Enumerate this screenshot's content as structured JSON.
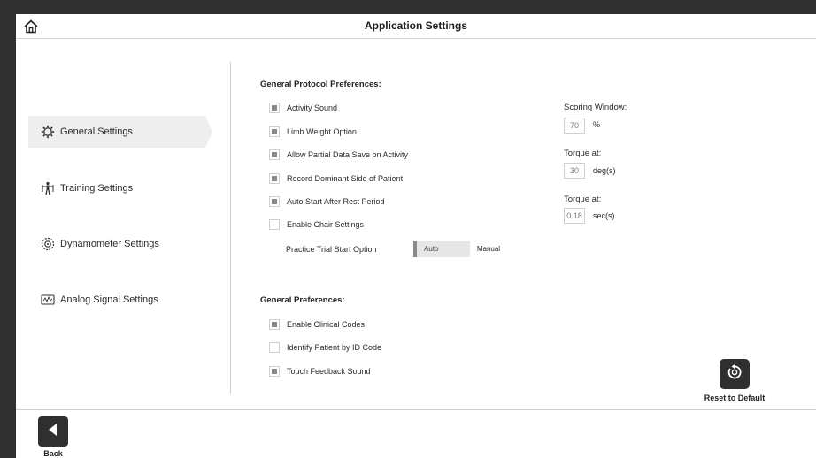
{
  "header": {
    "title": "Application Settings",
    "home_icon": "home-icon"
  },
  "sidebar": {
    "items": [
      {
        "label": "General Settings",
        "icon": "gear-icon",
        "active": true
      },
      {
        "label": "Training Settings",
        "icon": "training-figure-icon",
        "active": false
      },
      {
        "label": "Dynamometer Settings",
        "icon": "dynamometer-icon",
        "active": false
      },
      {
        "label": "Analog Signal Settings",
        "icon": "analog-signal-icon",
        "active": false
      }
    ]
  },
  "protocol": {
    "title": "General Protocol Preferences:",
    "options": [
      {
        "label": "Activity Sound",
        "checked": true
      },
      {
        "label": "Limb Weight Option",
        "checked": true
      },
      {
        "label": "Allow Partial Data Save on Activity",
        "checked": true
      },
      {
        "label": "Record Dominant Side of Patient",
        "checked": true
      },
      {
        "label": "Auto Start After Rest Period",
        "checked": true
      },
      {
        "label": "Enable Chair Settings",
        "checked": false
      }
    ],
    "practice_label": "Practice Trial Start Option",
    "practice_options": {
      "auto": "Auto",
      "manual": "Manual",
      "selected": "Auto"
    }
  },
  "scoring": {
    "scoring_window": {
      "label": "Scoring Window:",
      "value": "70",
      "unit": "%"
    },
    "torque_deg": {
      "label": "Torque at:",
      "value": "30",
      "unit": "deg(s)"
    },
    "torque_sec": {
      "label": "Torque at:",
      "value": "0.18",
      "unit": "sec(s)"
    }
  },
  "general": {
    "title": "General Preferences:",
    "options": [
      {
        "label": "Enable Clinical Codes",
        "checked": true
      },
      {
        "label": "Identify Patient by ID Code",
        "checked": false
      },
      {
        "label": "Touch Feedback Sound",
        "checked": true
      }
    ]
  },
  "actions": {
    "reset_label": "Reset to Default",
    "back_label": "Back"
  },
  "colors": {
    "dark": "#2f2f2f",
    "checked_fill": "#8a8a8a",
    "active_bg": "#eeeeee"
  }
}
